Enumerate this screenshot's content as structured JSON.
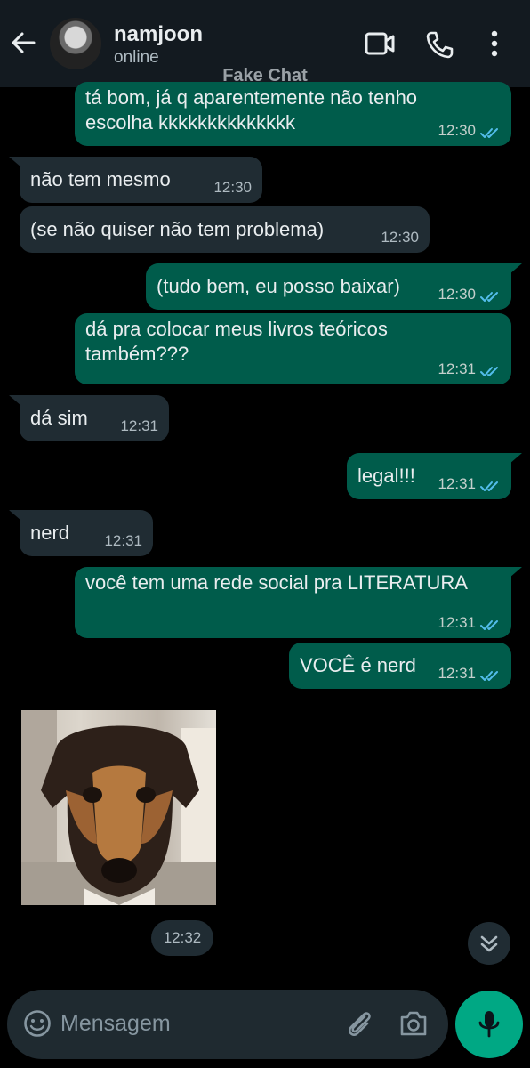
{
  "header": {
    "contact_name": "namjoon",
    "status": "online",
    "watermark": "Fake Chat",
    "icons": [
      "back-arrow-icon",
      "video-call-icon",
      "phone-icon",
      "more-menu-icon"
    ]
  },
  "messages": [
    {
      "dir": "out",
      "lines": [
        "tá bom, já q aparentemente  não tenho",
        "escolha kkkkkkkkkkkkkk"
      ],
      "time": "12:30",
      "read": true
    },
    {
      "dir": "in",
      "lines": [
        "não tem mesmo"
      ],
      "time": "12:30"
    },
    {
      "dir": "in",
      "lines": [
        "(se não quiser não tem problema)"
      ],
      "time": "12:30"
    },
    {
      "dir": "out",
      "lines": [
        "(tudo bem, eu posso baixar)"
      ],
      "time": "12:30",
      "read": true
    },
    {
      "dir": "out",
      "lines": [
        "dá pra colocar meus livros teóricos",
        "também???"
      ],
      "time": "12:31",
      "read": true
    },
    {
      "dir": "in",
      "lines": [
        "dá sim"
      ],
      "time": "12:31"
    },
    {
      "dir": "out",
      "lines": [
        "legal!!!"
      ],
      "time": "12:31",
      "read": true
    },
    {
      "dir": "in",
      "lines": [
        "nerd"
      ],
      "time": "12:31"
    },
    {
      "dir": "out",
      "lines": [
        "você tem uma rede social pra LITERATURA"
      ],
      "time": "12:31",
      "read": true
    },
    {
      "dir": "out",
      "lines": [
        "VOCÊ é nerd"
      ],
      "time": "12:31",
      "read": true
    }
  ],
  "image_message": {
    "time": "12:32",
    "content": "dog-photo"
  },
  "composer": {
    "placeholder": "Mensagem"
  },
  "colors": {
    "outgoing_bubble": "#005c4b",
    "incoming_bubble": "#202c33",
    "read_check": "#53bdeb",
    "mic_button": "#00a884",
    "background": "#000000"
  }
}
